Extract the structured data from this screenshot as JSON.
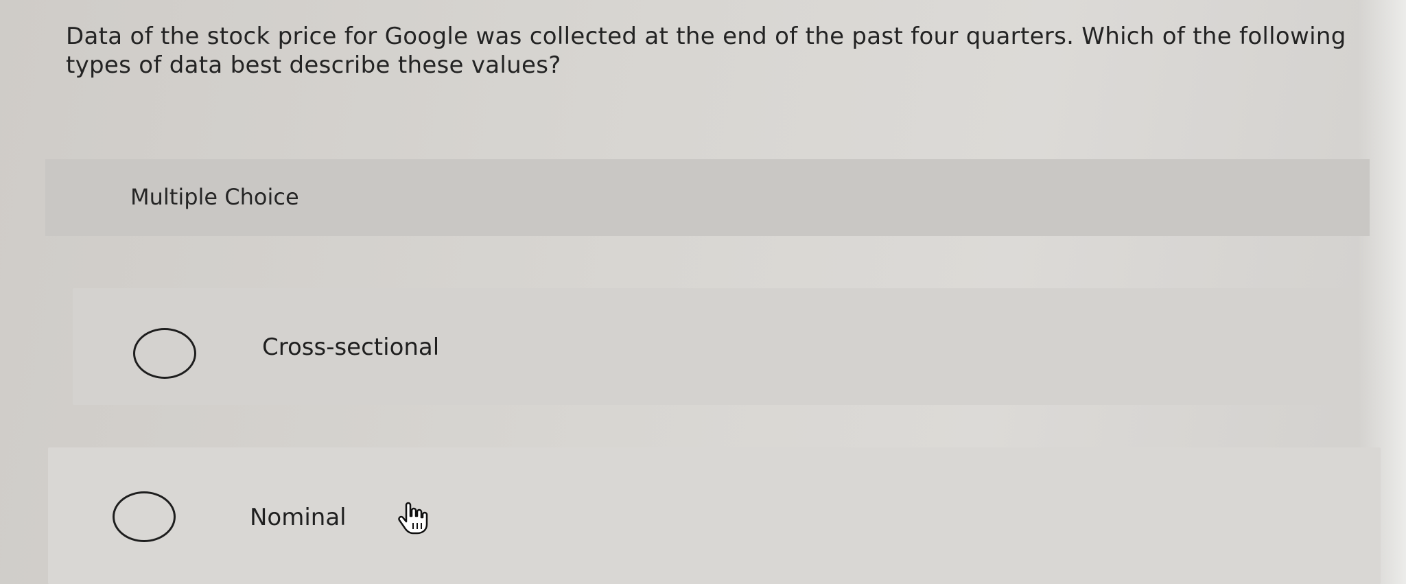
{
  "question": {
    "text": "Data of the stock price for Google was collected at the end of the past four quarters. Which of the following types of data best describe these values?"
  },
  "choices_header": {
    "label": "Multiple Choice"
  },
  "options": [
    {
      "label": "Cross-sectional",
      "selected": false
    },
    {
      "label": "Nominal",
      "selected": false
    }
  ],
  "cursor": {
    "icon": "hand-pointer-icon"
  }
}
